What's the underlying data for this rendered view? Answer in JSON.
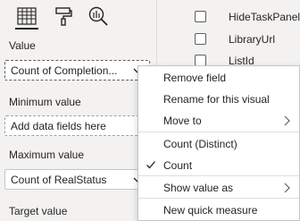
{
  "icons": {
    "fields": "fields-grid-icon",
    "format": "paint-roller-icon",
    "analytics": "magnifier-analytics-icon"
  },
  "wells": {
    "value": {
      "label": "Value",
      "field": "Count of Completion..."
    },
    "minimum": {
      "label": "Minimum value",
      "placeholder": "Add data fields here"
    },
    "maximum": {
      "label": "Maximum value",
      "field": "Count of RealStatus"
    },
    "target": {
      "label": "Target value"
    }
  },
  "field_list": [
    {
      "label": "HideTaskPanel",
      "checked": false
    },
    {
      "label": "LibraryUrl",
      "checked": false
    },
    {
      "label": "ListId",
      "checked": false
    }
  ],
  "context_menu": {
    "items": [
      {
        "label": "Remove field",
        "has_submenu": false,
        "checked": false
      },
      {
        "label": "Rename for this visual",
        "has_submenu": false,
        "checked": false
      },
      {
        "label": "Move to",
        "has_submenu": true,
        "checked": false
      },
      {
        "label": "Count (Distinct)",
        "has_submenu": false,
        "checked": false
      },
      {
        "label": "Count",
        "has_submenu": false,
        "checked": true
      },
      {
        "label": "Show value as",
        "has_submenu": true,
        "checked": false
      },
      {
        "label": "New quick measure",
        "has_submenu": false,
        "checked": false
      }
    ]
  },
  "colors": {
    "pane_bg": "#f3f2f1",
    "menu_bg": "#ffffff",
    "border": "#c8c6c4",
    "text": "#252423"
  }
}
